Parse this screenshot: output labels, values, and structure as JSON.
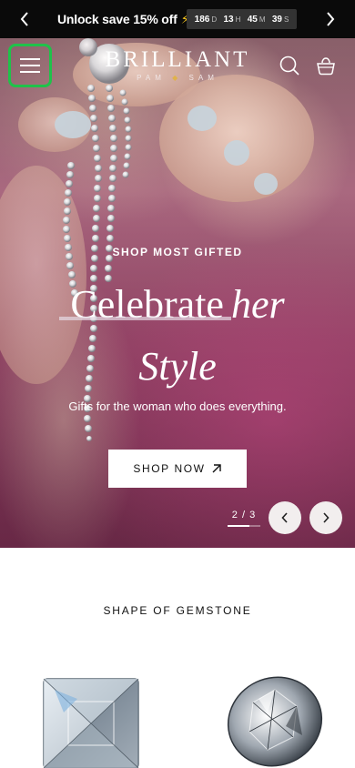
{
  "announcement": {
    "message": "Unlock save 15% off",
    "countdown": [
      {
        "num": "186",
        "unit": "D"
      },
      {
        "num": "13",
        "unit": "H"
      },
      {
        "num": "45",
        "unit": "M"
      },
      {
        "num": "39",
        "unit": "S"
      }
    ]
  },
  "header": {
    "brand": "BRILLIANT",
    "sub_left": "PAM",
    "sub_right": "SAM"
  },
  "hero": {
    "eyebrow": "SHOP MOST GIFTED",
    "headline_plain": "Celebrate",
    "headline_italic": "her",
    "headline_line2": "Style",
    "tagline": "Gifts for the woman who does everything.",
    "cta": "SHOP NOW",
    "pager": "2 / 3",
    "slide_current": 2,
    "slide_total": 3
  },
  "gemstones": {
    "title": "SHAPE OF GEMSTONE",
    "items": [
      "princess-cut-gem",
      "round-cut-gem"
    ]
  },
  "colors": {
    "bar": "#0a0a0a",
    "accent_bolt": "#f7c61d",
    "highlight": "#1fc24a"
  }
}
